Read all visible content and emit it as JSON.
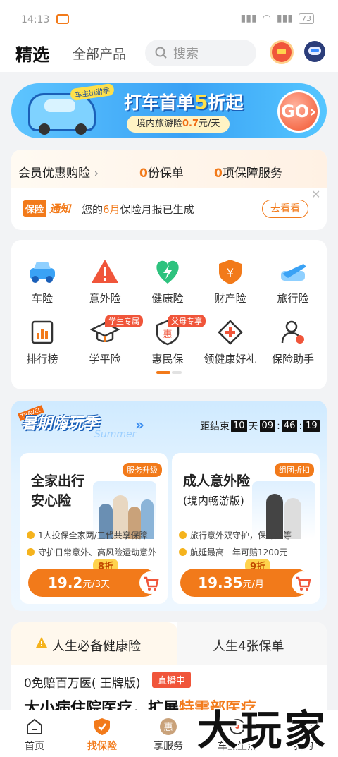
{
  "status": {
    "time": "14:13",
    "battery": "73"
  },
  "header": {
    "tab_selected": "精选",
    "tab_all": "全部产品",
    "search_placeholder": "搜索"
  },
  "banner": {
    "tag": "车主出游季",
    "headline_pre": "打车首单",
    "headline_num": "5",
    "headline_post": "折起",
    "sub_pre": "境内旅游险",
    "sub_price": "0.7",
    "sub_post": "元/天",
    "go": "GO"
  },
  "member": {
    "label": "会员优惠购险",
    "policies_num": "0",
    "policies_label": "份保单",
    "services_num": "0",
    "services_label": "项保障服务"
  },
  "notice": {
    "badge1": "保险",
    "badge2": "通知",
    "text_pre": "您的",
    "text_month": "6月",
    "text_post": "保险月报已生成",
    "button": "去看看"
  },
  "categories": [
    {
      "label": "车险",
      "icon": "car-icon",
      "color": "#3aa2f5"
    },
    {
      "label": "意外险",
      "icon": "warning-icon",
      "color": "#f0553a"
    },
    {
      "label": "健康险",
      "icon": "heart-bolt-icon",
      "color": "#2ec27e"
    },
    {
      "label": "财产险",
      "icon": "shield-yen-icon",
      "color": "#f27a1a"
    },
    {
      "label": "旅行险",
      "icon": "plane-icon",
      "color": "#3aa2f5"
    }
  ],
  "tools": [
    {
      "label": "排行榜",
      "icon": "chart-icon",
      "ribbon": ""
    },
    {
      "label": "学平险",
      "icon": "graduation-cap-icon",
      "ribbon": "学生专属"
    },
    {
      "label": "惠民保",
      "icon": "hui-icon",
      "ribbon": "父母专享"
    },
    {
      "label": "领健康好礼",
      "icon": "plus-diamond-icon",
      "ribbon": ""
    },
    {
      "label": "保险助手",
      "icon": "person-icon",
      "ribbon": ""
    }
  ],
  "summer": {
    "badge": "TRAVEL",
    "title": "暑期嗨玩季",
    "script": "Summer",
    "countdown_label": "距结束",
    "days": "10",
    "days_unit": "天",
    "hh": "09",
    "mm": "46",
    "ss": "19",
    "cards": [
      {
        "title_line1": "全家出行",
        "title_line2": "安心险",
        "tag": "服务升级",
        "feature1": "1人投保全家两/三代共享保障",
        "feature2": "守护日常意外、高风险运动意外",
        "discount": "8折",
        "price": "19.2",
        "unit": "元/3天"
      },
      {
        "title_line1": "成人意外险",
        "title_line2": "(境内畅游版)",
        "tag": "组团折扣",
        "feature1": "旅行意外双守护，保猝死等",
        "feature2": "航延最高一年可赔1200元",
        "discount": "9折",
        "price": "19.35",
        "unit": "元/月"
      }
    ]
  },
  "health": {
    "tab1": "人生必备健康险",
    "tab2": "人生4张保单",
    "product": "0免赔百万医( 王牌版)",
    "live": "直播中",
    "slogan_pre": "大小病住院医疗，扩展",
    "slogan_hl": "特需部医疗"
  },
  "nav": [
    {
      "label": "首页",
      "icon": "home-icon"
    },
    {
      "label": "找保险",
      "icon": "shield-check-icon"
    },
    {
      "label": "享服务",
      "icon": "hui-icon"
    },
    {
      "label": "车主生活",
      "icon": "car-life-icon"
    },
    {
      "label": "我的",
      "icon": "user-icon"
    }
  ],
  "watermark": "大玩家",
  "colors": {
    "accent": "#f27a1a",
    "red": "#f0553a",
    "blue": "#3aa2f5"
  }
}
